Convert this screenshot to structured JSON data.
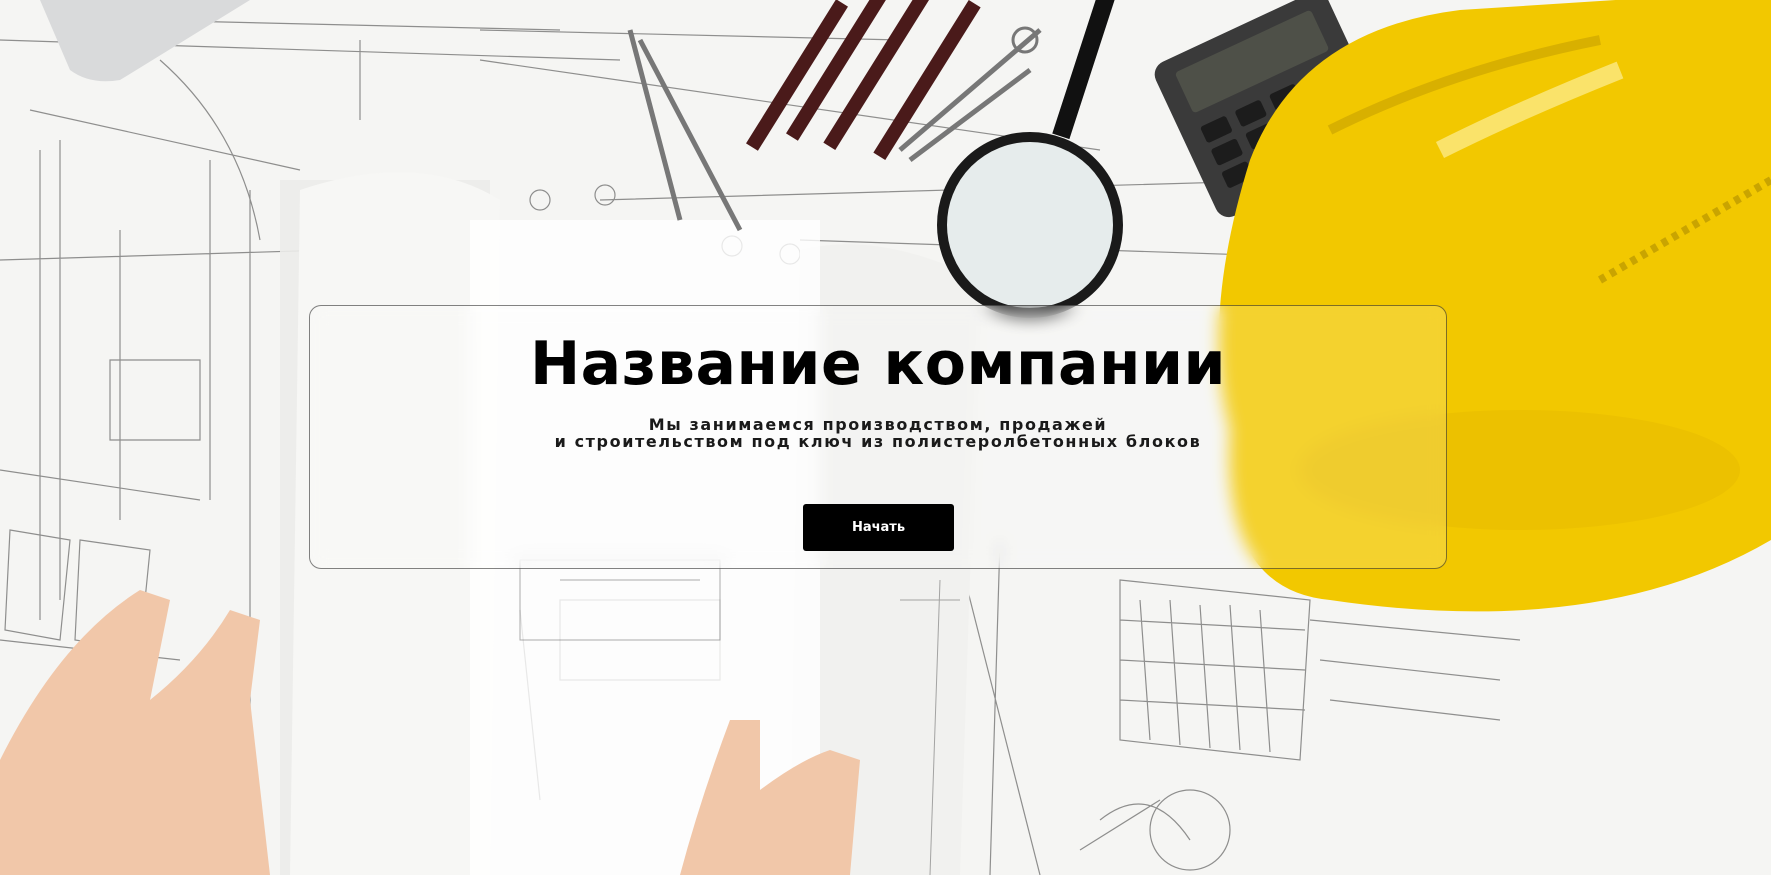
{
  "hero": {
    "title": "Название компании",
    "tagline_line1": "Мы занимаемся производством, продажей",
    "tagline_line2": "и строительством под ключ из полистеролбетонных блоков",
    "button_label": "Начать"
  },
  "colors": {
    "text": "#000000",
    "button_bg": "#000000",
    "button_text": "#ffffff",
    "helmet_yellow": "#f2c800",
    "paper": "#f6f6f4"
  },
  "icons": [
    "blueprint-background",
    "hard-hat-icon",
    "calculator-icon",
    "magnifying-glass-icon",
    "pencil-icon",
    "compass-icon"
  ]
}
